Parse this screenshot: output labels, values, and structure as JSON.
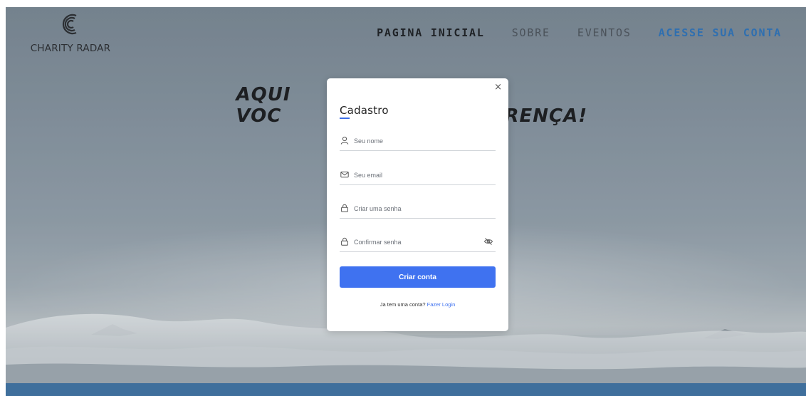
{
  "header": {
    "logo_text": "CHARITY RADAR",
    "nav": [
      {
        "label": "PAGINA INICIAL",
        "style": "dark"
      },
      {
        "label": "SOBRE",
        "style": "grey"
      },
      {
        "label": "EVENTOS",
        "style": "grey"
      },
      {
        "label": "ACESSE SUA CONTA",
        "style": "blue"
      }
    ]
  },
  "hero": {
    "title_left": "AQUI VOC",
    "title_right": "RENÇA!"
  },
  "modal": {
    "close_label": "×",
    "title": "Cadastro",
    "fields": [
      {
        "icon": "user-icon",
        "placeholder": "Seu nome"
      },
      {
        "icon": "mail-icon",
        "placeholder": "Seu email"
      },
      {
        "icon": "lock-icon",
        "placeholder": "Criar uma senha"
      },
      {
        "icon": "lock-icon",
        "placeholder": "Confirmar senha",
        "trailing_icon": "eye-off-icon"
      }
    ],
    "submit_label": "Criar conta",
    "login_prompt": "Ja tem uma conta?",
    "login_link": "Fazer Login"
  },
  "colors": {
    "accent": "#3f72f0",
    "nav_active": "#2f6fb0",
    "bottom_bar": "#3f6f9c"
  }
}
